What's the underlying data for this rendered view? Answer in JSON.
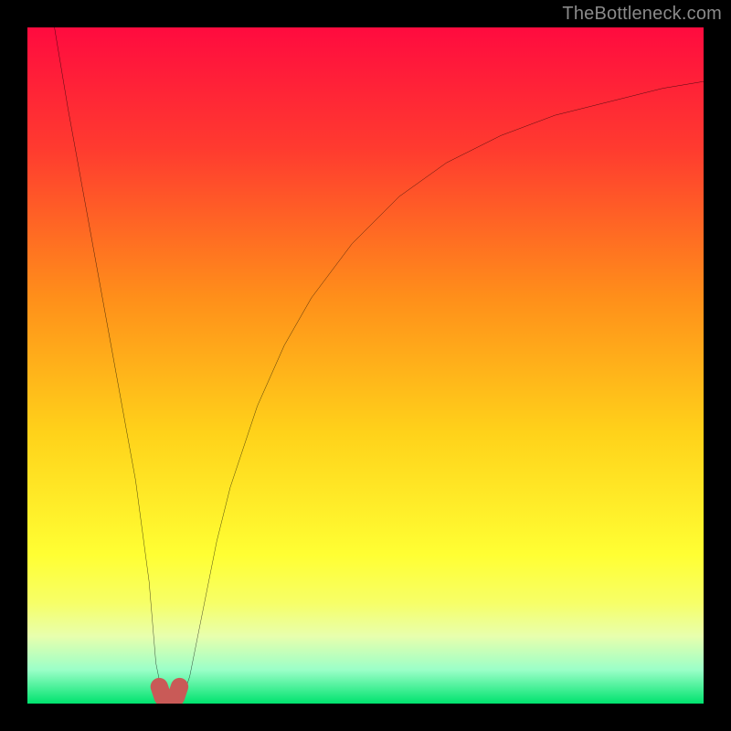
{
  "watermark": "TheBottleneck.com",
  "chart_data": {
    "type": "line",
    "title": "",
    "xlabel": "",
    "ylabel": "",
    "xlim": [
      0,
      100
    ],
    "ylim": [
      0,
      100
    ],
    "gradient_stops": [
      {
        "offset": 0,
        "color": "#ff0b3f"
      },
      {
        "offset": 0.18,
        "color": "#ff3b2f"
      },
      {
        "offset": 0.4,
        "color": "#ff8f1a"
      },
      {
        "offset": 0.6,
        "color": "#ffd21a"
      },
      {
        "offset": 0.78,
        "color": "#ffff33"
      },
      {
        "offset": 0.85,
        "color": "#f7ff66"
      },
      {
        "offset": 0.9,
        "color": "#e8ffad"
      },
      {
        "offset": 0.95,
        "color": "#9bffc8"
      },
      {
        "offset": 1.0,
        "color": "#00e36e"
      }
    ],
    "series": [
      {
        "name": "bottleneck-curve",
        "style": "black-line",
        "x": [
          4,
          6,
          8,
          10,
          12,
          14,
          16,
          18,
          19,
          20,
          21,
          22,
          23,
          24,
          26,
          28,
          30,
          34,
          38,
          42,
          48,
          55,
          62,
          70,
          78,
          86,
          94,
          100
        ],
        "values": [
          100,
          88,
          77,
          66,
          55,
          44,
          33,
          18,
          6,
          1,
          0,
          0,
          1,
          4,
          14,
          24,
          32,
          44,
          53,
          60,
          68,
          75,
          80,
          84,
          87,
          89,
          91,
          92
        ]
      },
      {
        "name": "optimal-zone",
        "style": "red-thick",
        "x": [
          19.5,
          20,
          20.5,
          21,
          21.5,
          22,
          22.5
        ],
        "values": [
          2.5,
          1.0,
          0.3,
          0.2,
          0.3,
          1.0,
          2.5
        ]
      }
    ]
  }
}
